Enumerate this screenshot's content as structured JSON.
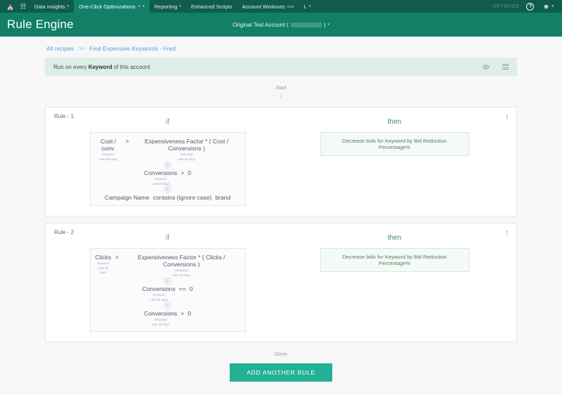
{
  "topnav": {
    "home_icon": "home-icon",
    "apps_icon": "apps-icon",
    "items": [
      {
        "label": "Data Insights",
        "caret": true,
        "active": false,
        "badge": "",
        "tm": false
      },
      {
        "label": "One-Click Optimizations",
        "caret": true,
        "active": true,
        "badge": "",
        "tm": true
      },
      {
        "label": "Reporting",
        "caret": true,
        "active": false,
        "badge": "",
        "tm": false
      },
      {
        "label": "Enhanced Scripts",
        "caret": false,
        "active": false,
        "badge": "",
        "tm": false
      },
      {
        "label": "Account Workouts",
        "caret": false,
        "active": false,
        "badge": "NEW",
        "tm": false
      },
      {
        "label": "L",
        "caret": true,
        "active": false,
        "badge": "",
        "tm": false
      }
    ],
    "brand": "OPTMYZR",
    "help_label": "?",
    "gear_icon": "gear-icon",
    "caret_glyph": "▾"
  },
  "header": {
    "title": "Rule Engine",
    "account_label": "Original Test Account (",
    "account_label_close": ")",
    "account_caret": "▾"
  },
  "breadcrumb": {
    "all_recipes": "All recipes",
    "separator": ">>",
    "current": "Find Expensive Keywords - Fred"
  },
  "runbar": {
    "prefix": "Run on every ",
    "entity": "Keyword",
    "suffix": " of this account",
    "eye_icon": "eye-icon",
    "list_icon": "list-icon"
  },
  "flow": {
    "start_label": "Start",
    "arrow_glyph": "↓",
    "done_label": "Done"
  },
  "labels": {
    "if": "if",
    "then": "then",
    "joiner": "&"
  },
  "rules": [
    {
      "title": "Rule - 1",
      "conditions": [
        {
          "left_name": "Cost / conv.",
          "left_meta1": "keyword",
          "left_meta2": "Last 30 days",
          "operator": ">",
          "right_name": "Expensiveness Factor * ( Cost / Conversions )",
          "right_meta1": "campaign",
          "right_meta2": "Last 30 days"
        },
        {
          "left_name": "Conversions",
          "left_meta1": "keyword",
          "left_meta2": "Last 30 days",
          "operator": ">",
          "right_name": "0",
          "right_meta1": "",
          "right_meta2": ""
        },
        {
          "left_name": "Campaign Name",
          "left_meta1": "",
          "left_meta2": "",
          "operator": "contains (ignore case)",
          "right_name": "brand",
          "right_meta1": "",
          "right_meta2": ""
        }
      ],
      "action": "Decrease bids for Keyword by Bid Reduction Percentage%"
    },
    {
      "title": "Rule - 2",
      "conditions": [
        {
          "left_name": "Clicks",
          "left_meta1": "keyword",
          "left_meta2": "Last 30 days",
          "operator": ">",
          "right_name": "Expensiveness Factor * ( Clicks / Conversions )",
          "right_meta1": "campaign",
          "right_meta2": "Last 30 days"
        },
        {
          "left_name": "Conversions",
          "left_meta1": "keyword",
          "left_meta2": "Last 30 days",
          "operator": "==",
          "right_name": "0",
          "right_meta1": "",
          "right_meta2": ""
        },
        {
          "left_name": "Conversions",
          "left_meta1": "campaign",
          "left_meta2": "Last 30 days",
          "operator": ">",
          "right_name": "0",
          "right_meta1": "",
          "right_meta2": ""
        }
      ],
      "action": "Decrease bids for Keyword by Bid Reduction Percentage%"
    }
  ],
  "footer": {
    "add_rule_label": "ADD ANOTHER RULE"
  },
  "colors": {
    "nav_bg": "#0f5c4d",
    "header_bg": "#127f67",
    "accent_teal": "#22b196",
    "link_blue": "#5a9fd4",
    "then_green": "#2f8f6f",
    "runbar_bg": "#ddeee8"
  }
}
